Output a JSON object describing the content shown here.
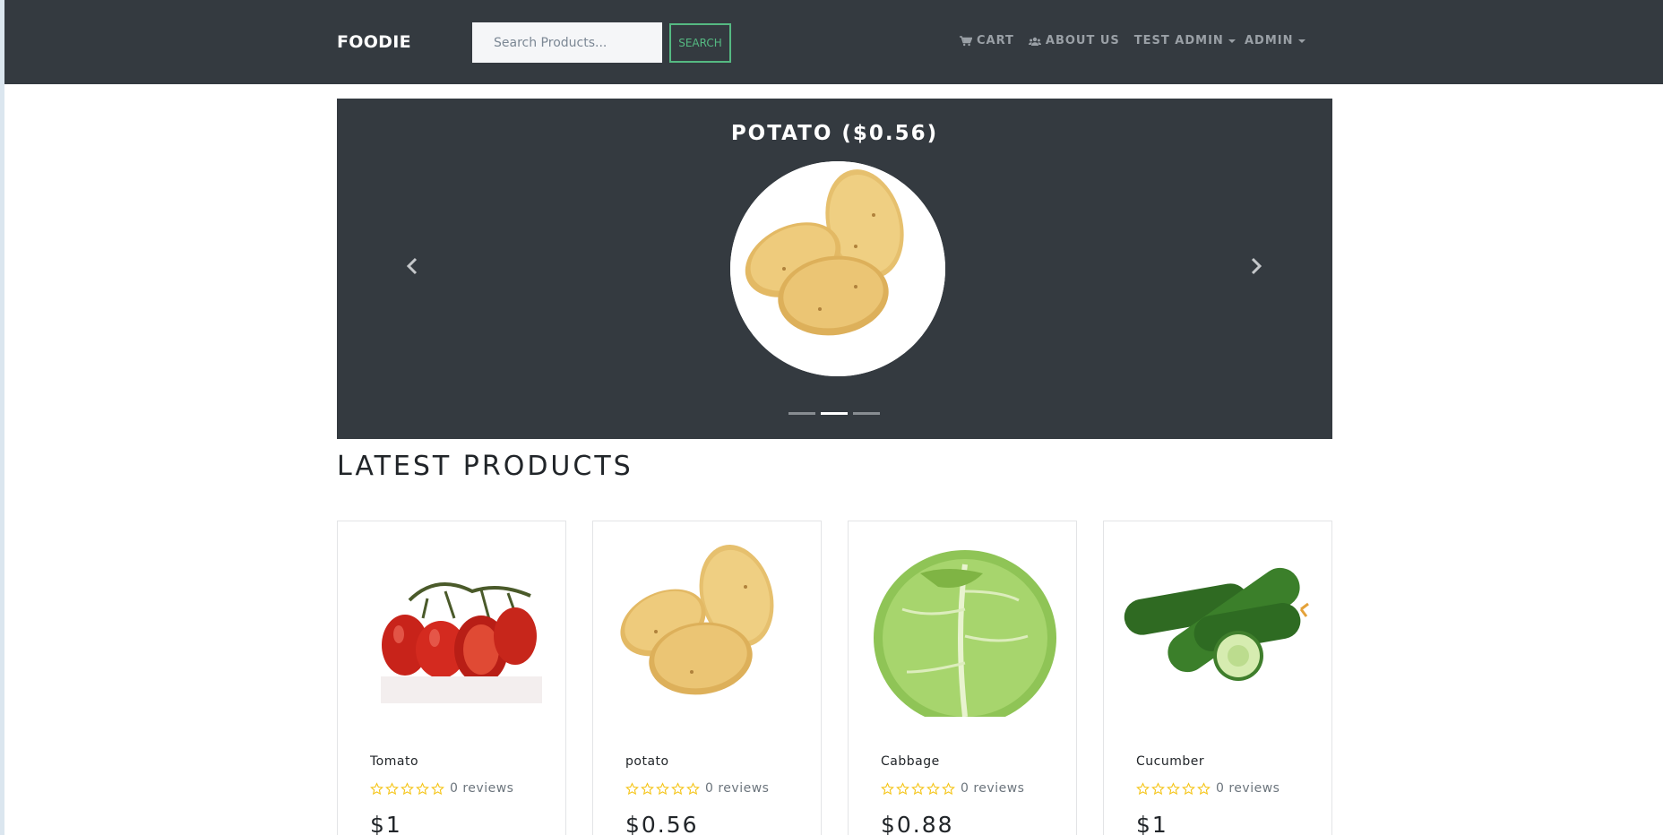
{
  "navbar": {
    "brand": "FOODIE",
    "search_placeholder": "Search Products...",
    "search_button": "SEARCH",
    "links": {
      "cart": "CART",
      "about": "ABOUT US",
      "user": "TEST ADMIN",
      "admin": "ADMIN"
    }
  },
  "carousel": {
    "title": "POTATO ($0.56)",
    "image": "potato",
    "slides": 3,
    "active_slide": 2
  },
  "section": {
    "title": "LATEST PRODUCTS"
  },
  "products": [
    {
      "name": "Tomato",
      "reviews": "0 reviews",
      "price": "$1",
      "image": "tomato"
    },
    {
      "name": "potato",
      "reviews": "0 reviews",
      "price": "$0.56",
      "image": "potato"
    },
    {
      "name": "Cabbage",
      "reviews": "0 reviews",
      "price": "$0.88",
      "image": "cabbage"
    },
    {
      "name": "Cucumber",
      "reviews": "0 reviews",
      "price": "$1",
      "image": "cucumber"
    }
  ],
  "colors": {
    "navbar_bg": "#343a40",
    "accent_green": "#55b982",
    "star": "#f5c518"
  }
}
